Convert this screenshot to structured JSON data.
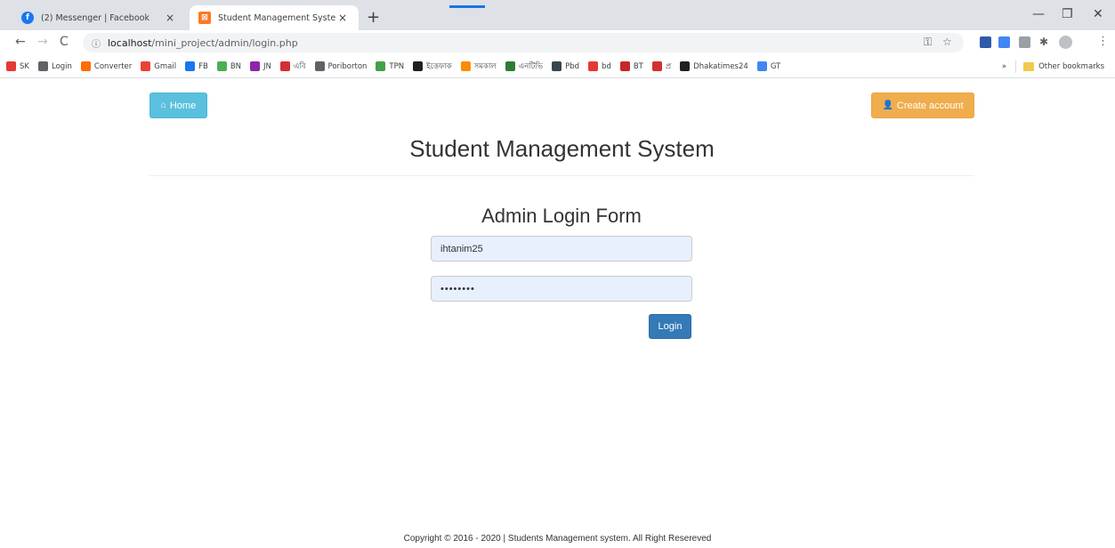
{
  "browser": {
    "tabs": [
      {
        "title": "(2) Messenger | Facebook",
        "favicon": "facebook-icon",
        "color": "#1877f2"
      },
      {
        "title": "Student Management System",
        "favicon": "xampp-icon",
        "color": "#fb7a24"
      }
    ],
    "close_glyph": "×",
    "newtab_glyph": "+",
    "url_host": "localhost",
    "url_path": "/mini_project/admin/login.php",
    "bookmarks": [
      {
        "label": "SK",
        "color": "#e53935"
      },
      {
        "label": "Login",
        "color": "#5f6368"
      },
      {
        "label": "Converter",
        "color": "#ff6d00"
      },
      {
        "label": "Gmail",
        "color": "#ea4335"
      },
      {
        "label": "FB",
        "color": "#1877f2"
      },
      {
        "label": "BN",
        "color": "#4caf50"
      },
      {
        "label": "JN",
        "color": "#8e24aa"
      },
      {
        "label": "এবি",
        "color": "#d32f2f"
      },
      {
        "label": "Poriborton",
        "color": "#5f6368"
      },
      {
        "label": "TPN",
        "color": "#43a047"
      },
      {
        "label": "ইত্তেফাক",
        "color": "#212121"
      },
      {
        "label": "সমকাল",
        "color": "#fb8c00"
      },
      {
        "label": "এনটিভি",
        "color": "#2e7d32"
      },
      {
        "label": "Pbd",
        "color": "#37474f"
      },
      {
        "label": "bd",
        "color": "#e53935"
      },
      {
        "label": "BT",
        "color": "#c62828"
      },
      {
        "label": "প্র",
        "color": "#d32f2f"
      },
      {
        "label": "Dhakatimes24",
        "color": "#212121"
      },
      {
        "label": "GT",
        "color": "#4285f4"
      }
    ],
    "more_glyph": "»",
    "other_bookmarks": "Other bookmarks"
  },
  "page": {
    "home_label": "Home",
    "create_label": "Create account",
    "title": "Student Management System",
    "form_title": "Admin Login Form",
    "username_value": "ihtanim25",
    "password_value": "••••••••",
    "login_label": "Login",
    "footer": "Copyright © 2016 - 2020 | Students Management system. All Right Resereved"
  },
  "colors": {
    "home": "#5bc0de",
    "create": "#f0ad4e",
    "login": "#337ab7"
  }
}
